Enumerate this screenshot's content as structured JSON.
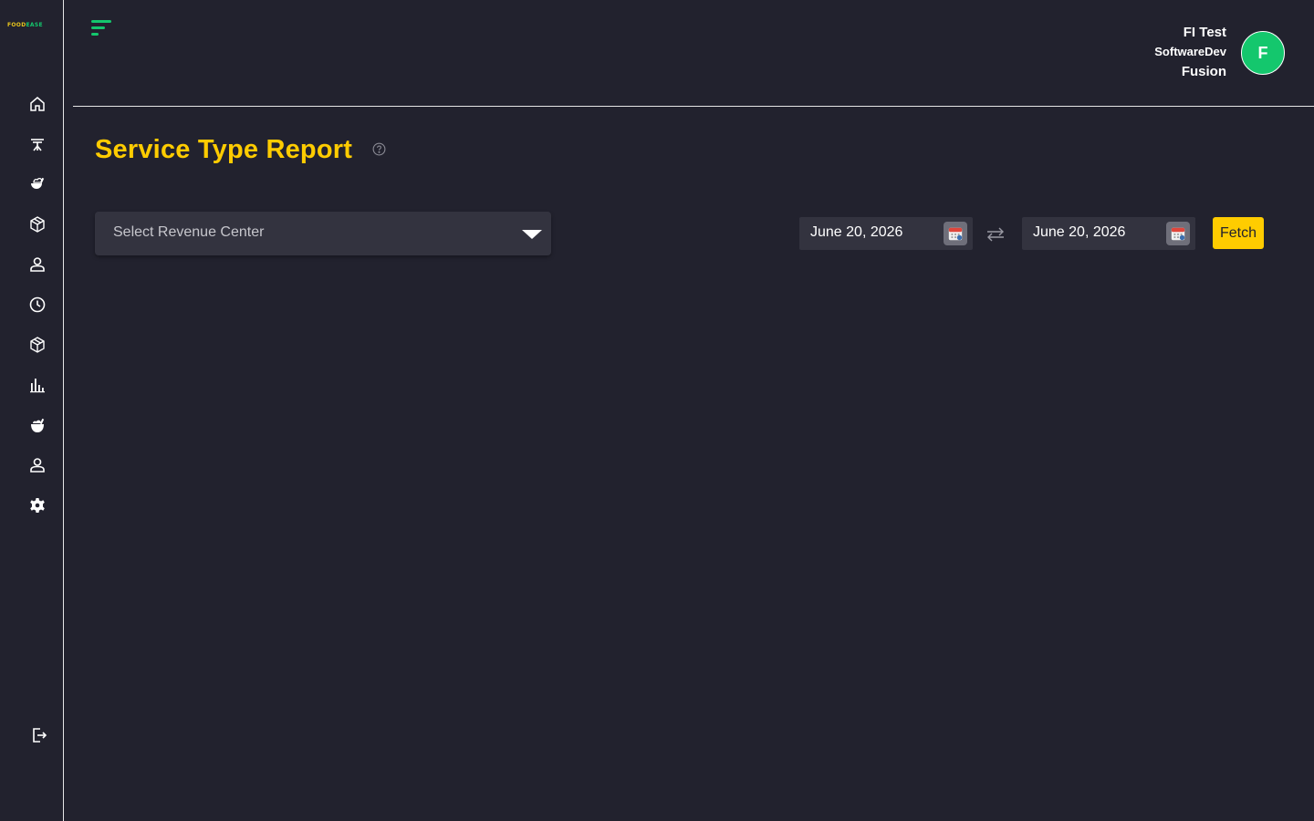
{
  "sidebar": {
    "logo": {
      "part1": "FOOD",
      "part2": "EASE"
    },
    "items": [
      {
        "icon": "home-icon"
      },
      {
        "icon": "dining-table-icon"
      },
      {
        "icon": "food-icon"
      },
      {
        "icon": "box-icon"
      },
      {
        "icon": "user-icon"
      },
      {
        "icon": "clock-icon"
      },
      {
        "icon": "inventory-box-icon"
      },
      {
        "icon": "bar-chart-icon"
      },
      {
        "icon": "fruit-icon"
      },
      {
        "icon": "staff-icon"
      },
      {
        "icon": "settings-icon"
      }
    ],
    "logout": {
      "icon": "logout-icon"
    }
  },
  "header": {
    "user": {
      "name": "FI Test",
      "org": "SoftwareDev",
      "sub": "Fusion",
      "avatar_initial": "F"
    }
  },
  "main": {
    "title": "Service Type Report",
    "revenue_center": {
      "placeholder": "Select Revenue Center"
    },
    "date_from": "June 20, 2026",
    "date_to": "June 20, 2026",
    "fetch_label": "Fetch"
  },
  "colors": {
    "background": "#22222e",
    "accent_yellow": "#ffcc00",
    "accent_green": "#14c76d",
    "input_bg": "#33333f"
  }
}
